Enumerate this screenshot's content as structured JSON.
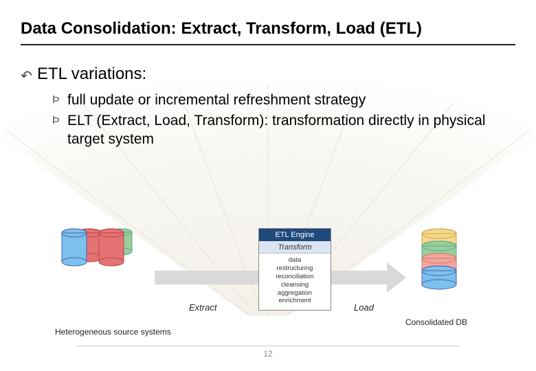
{
  "title": "Data Consolidation: Extract, Transform, Load (ETL)",
  "main_bullet": "ETL variations:",
  "sub_bullets": [
    "full update or incremental refreshment strategy",
    "ELT (Extract, Load, Transform): transformation directly in physical target system"
  ],
  "diagram": {
    "source_label": "Heterogeneous source systems",
    "extract_label": "Extract",
    "load_label": "Load",
    "engine_header": "ETL Engine",
    "engine_subheader": "Transform",
    "engine_steps": "data\nrestructuring\nreconciliation\ncleansing\naggregation\nenrichment",
    "consolidated_label": "Consolidated DB",
    "source_colors": [
      "#e57373",
      "#9ccc9c",
      "#7ec0ee",
      "#e57373"
    ],
    "target_colors": [
      "#f6d88b",
      "#9ccc9c",
      "#f4a6a0",
      "#7ec0ee"
    ]
  },
  "page_number": "12"
}
